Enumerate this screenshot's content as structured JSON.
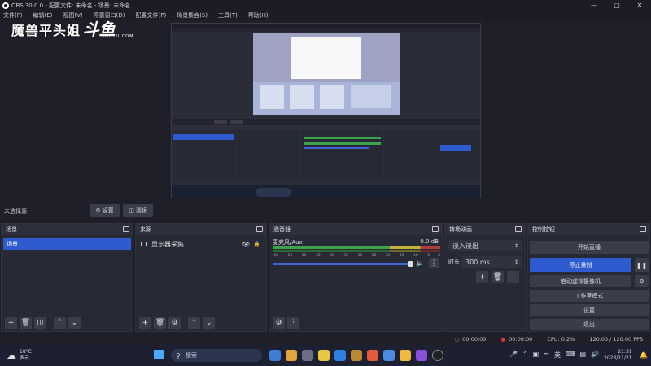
{
  "window": {
    "title": "OBS 30.0.0 - 配置文件: 未命名 - 场景: 未命名",
    "minimize_icon": "minimize-icon",
    "maximize_icon": "maximize-icon",
    "close_icon": "close-icon"
  },
  "menu": {
    "items": [
      "文件(F)",
      "编辑(E)",
      "视图(V)",
      "停靠窗口(D)",
      "配置文件(P)",
      "场景集合(S)",
      "工具(T)",
      "帮助(H)"
    ]
  },
  "watermark": {
    "streamer": "魔兽平头姐",
    "logo": "斗鱼",
    "site": "DOUYU.COM"
  },
  "scene_bar": {
    "no_selection": "未选择源",
    "settings_label": "设置",
    "filters_label": "滤镜"
  },
  "scenes": {
    "title": "场景",
    "items": [
      "场景"
    ]
  },
  "sources": {
    "title": "来源",
    "items": [
      {
        "name": "显示器采集"
      }
    ]
  },
  "mixer": {
    "title": "混音器",
    "track": "麦克风/Aux",
    "db": "0.0 dB",
    "scale": [
      "-60",
      "-55",
      "-50",
      "-45",
      "-40",
      "-35",
      "-30",
      "-25",
      "-20",
      "-15",
      "-10",
      "-5",
      "0"
    ]
  },
  "transitions": {
    "title": "转场动画",
    "type": "淡入淡出",
    "duration_label": "时长",
    "duration": "300 ms"
  },
  "controls": {
    "title": "控制按钮",
    "start_stream": "开始直播",
    "stop_record": "停止录制",
    "virtual_cam": "启动虚拟摄像机",
    "studio_mode": "工作室模式",
    "settings": "设置",
    "exit": "退出"
  },
  "statusbar": {
    "stream_time": "00:00:00",
    "record_time": "00:00:00",
    "cpu": "CPU: 0.2%",
    "fps": "120.00 / 120.00 FPS"
  },
  "taskbar": {
    "weather_temp": "18°C",
    "weather_desc": "多云",
    "search": "搜索",
    "lang": "英",
    "time": "21:31",
    "date": "2023/11/21"
  },
  "colors": {
    "accent": "#2e5bd0",
    "panel": "#272935",
    "background": "#1e1f29"
  }
}
